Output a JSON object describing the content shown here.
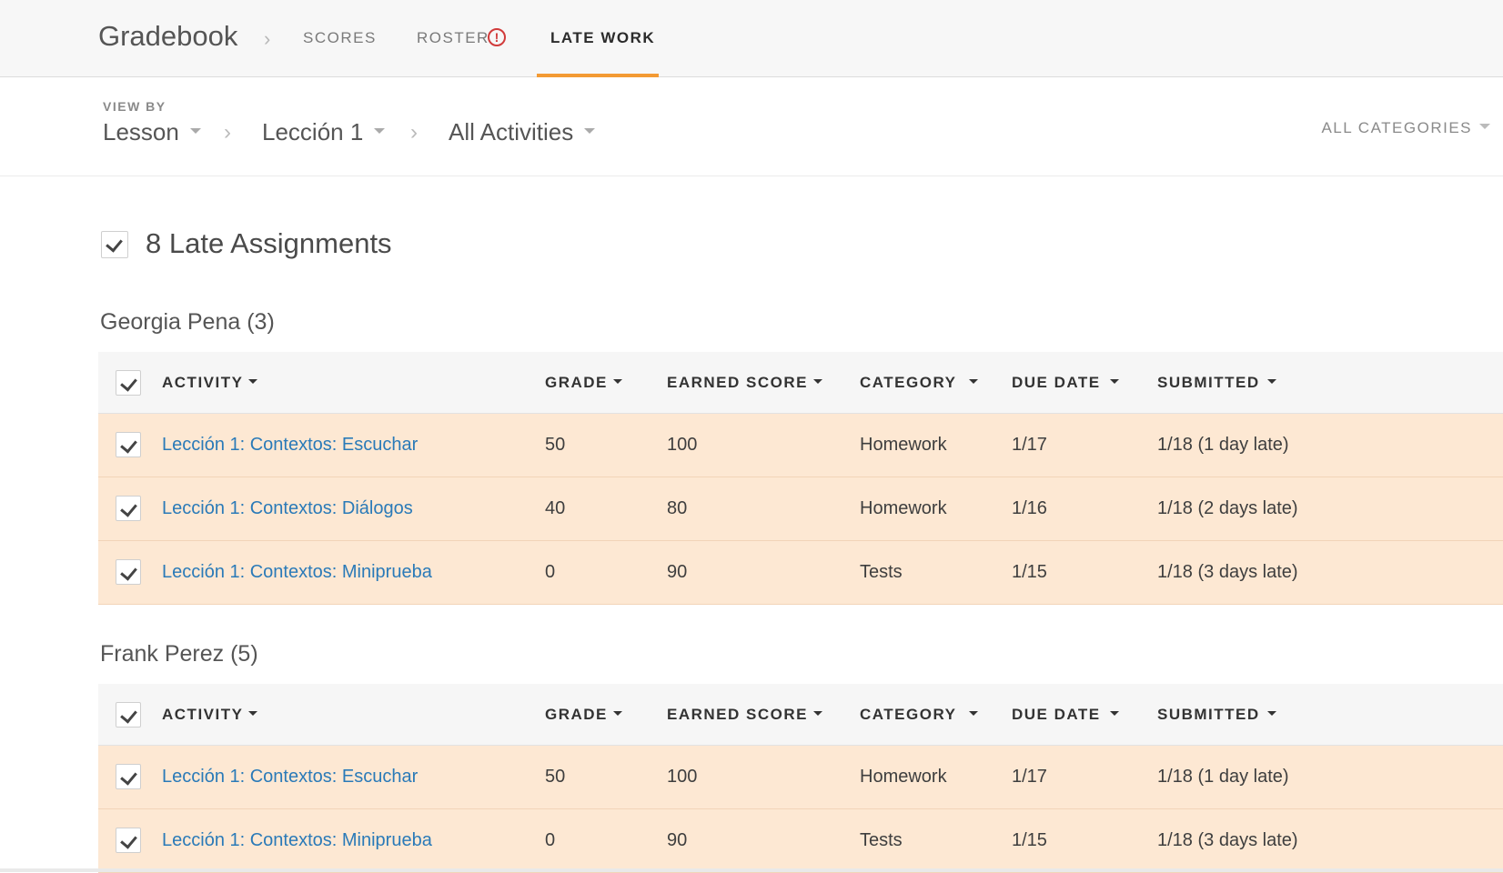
{
  "nav": {
    "brand": "Gradebook",
    "tabs": [
      {
        "label": "SCORES"
      },
      {
        "label": "ROSTER",
        "alert": "!"
      },
      {
        "label": "LATE WORK",
        "active": true
      }
    ]
  },
  "viewby": {
    "label": "VIEW BY",
    "level": "Lesson",
    "lesson": "Lección 1",
    "activities": "All Activities",
    "categories": "ALL CATEGORIES"
  },
  "summary": {
    "title": "8 Late Assignments"
  },
  "columns": {
    "activity": "ACTIVITY",
    "grade": "GRADE",
    "earned": "EARNED SCORE",
    "category": "CATEGORY",
    "due": "DUE DATE",
    "submitted": "SUBMITTED"
  },
  "students": [
    {
      "name": "Georgia Pena (3)",
      "rows": [
        {
          "activity": "Lección 1: Contextos: Escuchar",
          "grade": "50",
          "earned": "100",
          "category": "Homework",
          "due": "1/17",
          "submitted": "1/18 (1 day late)"
        },
        {
          "activity": "Lección 1: Contextos: Diálogos",
          "grade": "40",
          "earned": "80",
          "category": "Homework",
          "due": "1/16",
          "submitted": "1/18 (2 days late)"
        },
        {
          "activity": "Lección 1: Contextos: Miniprueba",
          "grade": "0",
          "earned": "90",
          "category": "Tests",
          "due": "1/15",
          "submitted": "1/18 (3 days late)"
        }
      ]
    },
    {
      "name": "Frank Perez (5)",
      "rows": [
        {
          "activity": "Lección 1: Contextos: Escuchar",
          "grade": "50",
          "earned": "100",
          "category": "Homework",
          "due": "1/17",
          "submitted": "1/18 (1 day late)"
        },
        {
          "activity": "Lección 1: Contextos: Miniprueba",
          "grade": "0",
          "earned": "90",
          "category": "Tests",
          "due": "1/15",
          "submitted": "1/18 (3 days late)"
        }
      ]
    }
  ],
  "colors": {
    "accent": "#f39a34",
    "row_bg": "#fde8d3",
    "link": "#2a7ab8",
    "alert": "#d13b3b"
  }
}
